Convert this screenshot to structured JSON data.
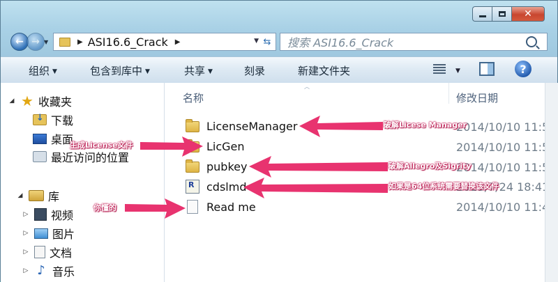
{
  "window": {
    "minimize_label": "",
    "close_label": "✕"
  },
  "address": {
    "path": "ASI16.6_Crack",
    "search_placeholder": "搜索 ASI16.6_Crack"
  },
  "toolbar": {
    "organize": "组织",
    "include_in_library": "包含到库中",
    "share": "共享",
    "burn": "刻录",
    "new_folder": "新建文件夹",
    "help": "?"
  },
  "nav": {
    "favorites": "收藏夹",
    "downloads": "下载",
    "desktop": "桌面",
    "recent": "最近访问的位置",
    "libraries": "库",
    "videos": "视频",
    "pictures": "图片",
    "documents": "文档",
    "music": "音乐"
  },
  "columns": {
    "name": "名称",
    "date_modified": "修改日期"
  },
  "files": [
    {
      "name": "LicenseManager",
      "date": "2014/10/10 11:5",
      "icon": "folder-icon"
    },
    {
      "name": "LicGen",
      "date": "2014/10/10 11:5",
      "icon": "folder-icon"
    },
    {
      "name": "pubkey",
      "date": "2014/10/10 11:5",
      "icon": "folder-icon"
    },
    {
      "name": "cdslmd",
      "date": "2013/7/24 18:41",
      "icon": "executable-icon"
    },
    {
      "name": "Read me",
      "date": "2014/10/10 11:4",
      "icon": "text-file-icon"
    }
  ],
  "annotations": {
    "license_manager": "破解Licese Manager",
    "licgen": "生成License文件",
    "pubkey": "破解Allegro及Sigrity",
    "cdslmd": "如果是64位系统需要替换该文件",
    "readme": "你懂的"
  },
  "colors": {
    "annotation_arrow": "#e8336f",
    "close_button": "#c8462f"
  }
}
